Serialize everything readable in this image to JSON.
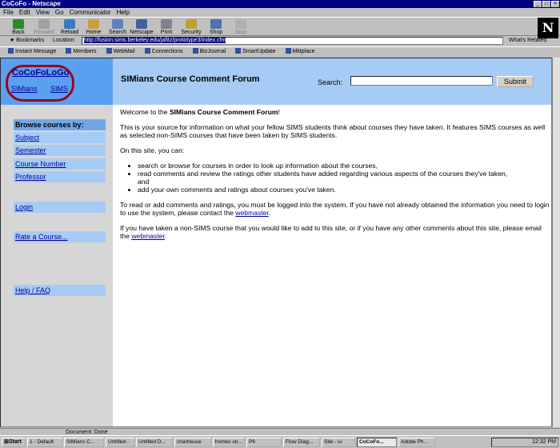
{
  "window": {
    "title": "CoCoFo - Netscape"
  },
  "menu": [
    "File",
    "Edit",
    "View",
    "Go",
    "Communicator",
    "Help"
  ],
  "toolbar": {
    "back": "Back",
    "forward": "Forward",
    "reload": "Reload",
    "home": "Home",
    "search": "Search",
    "netscape": "Netscape",
    "print": "Print",
    "security": "Security",
    "shop": "Shop",
    "stop": "Stop"
  },
  "location": {
    "bookmarks": "Bookmarks",
    "label": "Location:",
    "url": "http://fusion.sims.berkeley.edu/jafitz/prototype3/index.cfm",
    "related": "What's Related"
  },
  "personal": [
    "Instant Message",
    "Members",
    "WebMail",
    "Connections",
    "BizJournal",
    "SmartUpdate",
    "Mktplace"
  ],
  "site": {
    "logo": "CoCoFoLoGo",
    "simians_link": "SIMians",
    "sims_link": "SIMS",
    "title": "SIMians Course Comment Forum",
    "search_label": "Search:",
    "submit": "Submit"
  },
  "nav": {
    "browse_header": "Browse courses by:",
    "subject": "Subject",
    "semester": "Semester",
    "course_number": "Course Number",
    "professor": "Professor",
    "login": "Login",
    "rate": "Rate a Course...",
    "help": "Help / FAQ"
  },
  "body": {
    "welcome_pre": "Welcome to the ",
    "welcome_bold": "SIMians Course Comment Forum",
    "welcome_post": "!",
    "intro": "This is your source for information on what your fellow SIMS students think about courses they have taken. It features SIMS courses as well as selected non-SIMS courses that have been taken by SIMS students.",
    "can": "On this site, you can:",
    "bullet1": "search or browse for courses in order to look up information about the courses,",
    "bullet2": "read comments and review the ratings other students have added regarding various aspects of the courses they've taken,",
    "bullet2_and": "and",
    "bullet3": "add your own comments and ratings about courses you've taken.",
    "login_para": "To read or add comments and ratings, you must be logged into the system. If you have not already obtained the information you need to login to use the system, please contact the ",
    "webmaster": "webmaster",
    "period": ".",
    "nonsims_para": "If you have taken a non-SIMS course that you would like to add to this site, or if you have any other comments about this site, please email the "
  },
  "status": "Document: Done",
  "taskbar": {
    "start": "Start",
    "tasks": [
      "1 - Default",
      "SIMians C...",
      "Untitled -",
      "Untitled D...",
      "chartreuse",
      "homes on...",
      "P6",
      "Flow Diag...",
      "Site - ui",
      "CoCoFo...",
      "Adobe Ph..."
    ],
    "clock": "12:32 PM"
  }
}
